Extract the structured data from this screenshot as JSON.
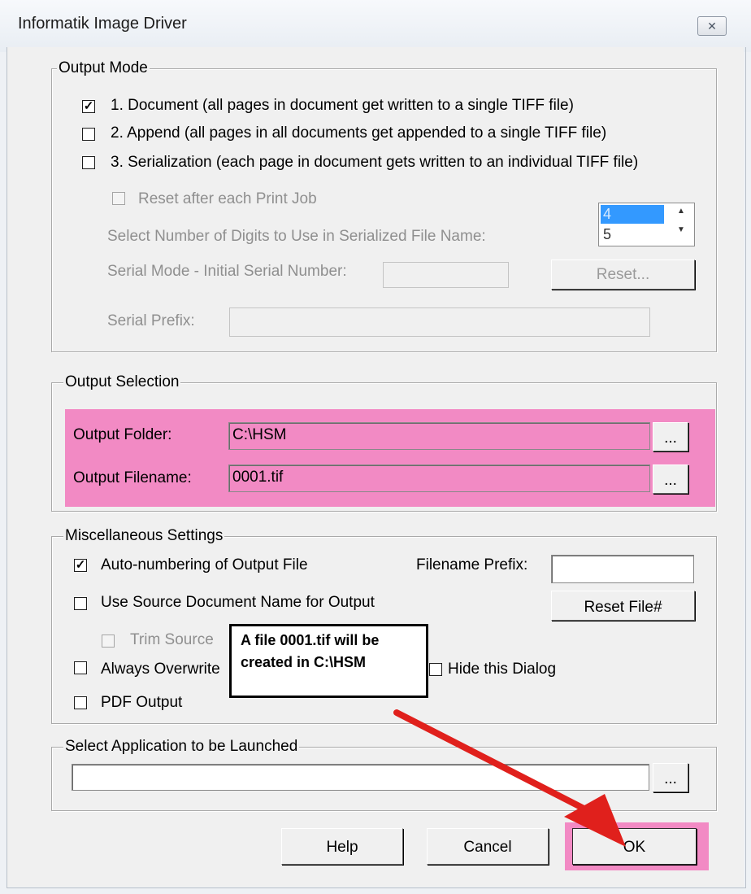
{
  "window": {
    "title": "Informatik Image Driver",
    "close_glyph": "✕"
  },
  "output_mode": {
    "legend": "Output Mode",
    "options": [
      {
        "label": "1. Document (all pages in document get written to a single TIFF file)",
        "checked": true
      },
      {
        "label": "2. Append (all pages in all documents get appended to a single TIFF file)",
        "checked": false
      },
      {
        "label": "3. Serialization (each page in document gets written to an individual TIFF file)",
        "checked": false
      }
    ],
    "reset_after_print_job": "Reset after each Print Job",
    "digits_label": "Select Number of Digits to Use in Serialized File Name:",
    "digits_options": [
      "4",
      "5"
    ],
    "digits_selected": "4",
    "initial_serial_label": "Serial Mode - Initial Serial Number:",
    "initial_serial_value": "",
    "reset_button": "Reset...",
    "serial_prefix_label": "Serial Prefix:",
    "serial_prefix_value": ""
  },
  "output_selection": {
    "legend": "Output Selection",
    "folder_label": "Output Folder:",
    "folder_value": "C:\\HSM",
    "filename_label": "Output Filename:",
    "filename_value": "0001.tif",
    "browse_label": "...",
    "highlight_color": "#f28ac4"
  },
  "misc": {
    "legend": "Miscellaneous Settings",
    "auto_numbering": "Auto-numbering of Output File",
    "auto_numbering_checked": true,
    "filename_prefix_label": "Filename Prefix:",
    "filename_prefix_value": "",
    "use_source_name": "Use Source Document Name for Output",
    "reset_file_button": "Reset File#",
    "trim_source": "Trim Source",
    "always_overwrite": "Always Overwrite",
    "hide_dialog": "Hide this Dialog",
    "pdf_output": "PDF Output"
  },
  "launch": {
    "legend": "Select Application to be Launched",
    "value": "",
    "browse_label": "..."
  },
  "buttons": {
    "help": "Help",
    "cancel": "Cancel",
    "ok": "OK"
  },
  "annotation": {
    "line1": "A file 0001.tif will be",
    "line2": "created in C:\\HSM",
    "arrow_color": "#e0201c"
  },
  "glyphs": {
    "check": "✓",
    "up": "▲",
    "down": "▼"
  }
}
